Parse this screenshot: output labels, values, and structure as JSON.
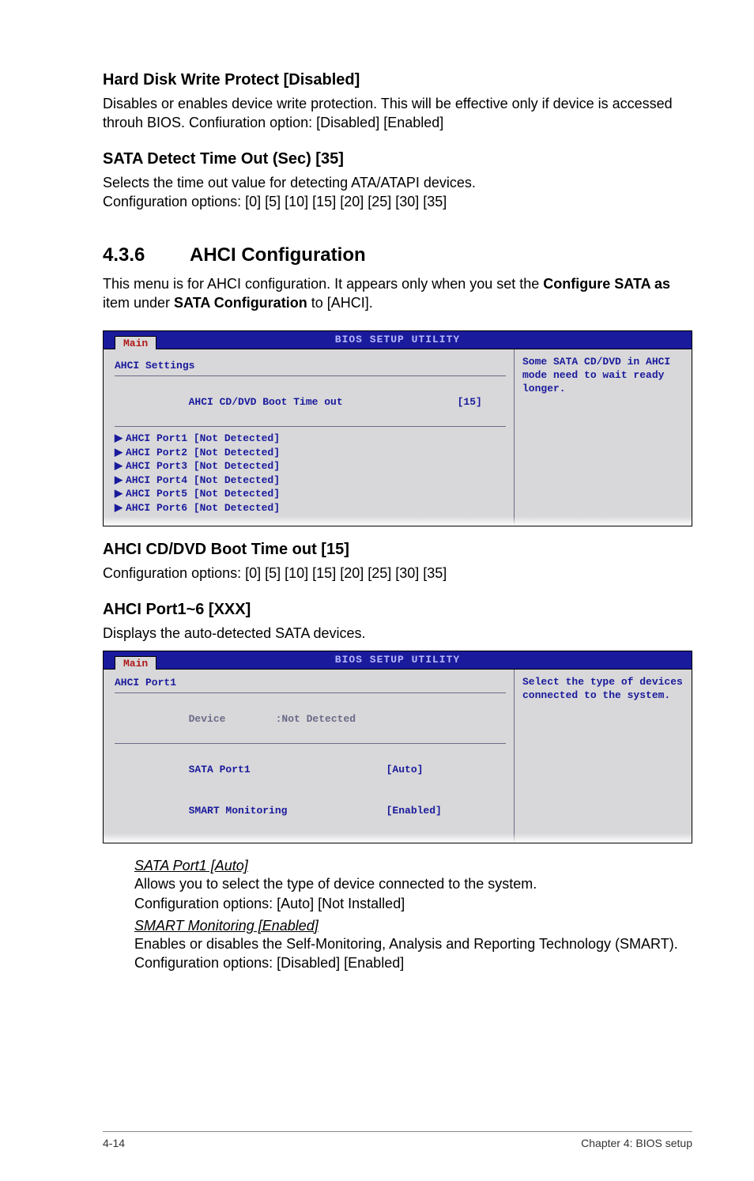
{
  "h1": {
    "title": "Hard Disk Write Protect [Disabled]",
    "body": "Disables or enables device write protection. This will be effective only if device is accessed throuh BIOS. Confiuration option: [Disabled] [Enabled]"
  },
  "h2": {
    "title": "SATA Detect Time Out (Sec) [35]",
    "body1": "Selects the time out value for detecting ATA/ATAPI devices.",
    "body2": "Configuration options: [0] [5] [10] [15] [20] [25] [30] [35]"
  },
  "section": {
    "num": "4.3.6",
    "title": "AHCI Configuration",
    "intro_pre": "This menu is for AHCI configuration. It appears only when you set the ",
    "intro_bold1": "Configure SATA as",
    "intro_mid": " item under ",
    "intro_bold2": "SATA Configuration",
    "intro_post": " to [AHCI]."
  },
  "bios1": {
    "utility_title": "BIOS SETUP UTILITY",
    "tab": "Main",
    "frame_title": "AHCI Settings",
    "row1_label": "AHCI CD/DVD Boot Time out",
    "row1_value": "[15]",
    "ports": [
      "AHCI Port1 [Not Detected]",
      "AHCI Port2 [Not Detected]",
      "AHCI Port3 [Not Detected]",
      "AHCI Port4 [Not Detected]",
      "AHCI Port5 [Not Detected]",
      "AHCI Port6 [Not Detected]"
    ],
    "help": "Some SATA CD/DVD in AHCI mode need to wait ready longer."
  },
  "h3": {
    "title": "AHCI CD/DVD Boot Time out [15]",
    "body": "Configuration options: [0] [5] [10] [15] [20] [25] [30] [35]"
  },
  "h4": {
    "title": "AHCI Port1~6 [XXX]",
    "body": "Displays the auto-detected SATA devices."
  },
  "bios2": {
    "utility_title": "BIOS SETUP UTILITY",
    "tab": "Main",
    "frame_title": "AHCI Port1",
    "device_label": "Device",
    "device_value": ":Not Detected",
    "row1_label": "SATA Port1",
    "row1_value": "[Auto]",
    "row2_label": "SMART Monitoring",
    "row2_value": "[Enabled]",
    "help": "Select the type of devices connected to the system."
  },
  "sub1": {
    "title": "SATA Port1 [Auto]",
    "line1": "Allows you to select the type of device connected to the system.",
    "line2": "Configuration options: [Auto] [Not Installed]"
  },
  "sub2": {
    "title": "SMART Monitoring [Enabled]",
    "line1": "Enables or disables the Self-Monitoring, Analysis and Reporting Technology (SMART). Configuration options: [Disabled] [Enabled]"
  },
  "footer": {
    "left": "4-14",
    "right": "Chapter 4: BIOS setup"
  }
}
